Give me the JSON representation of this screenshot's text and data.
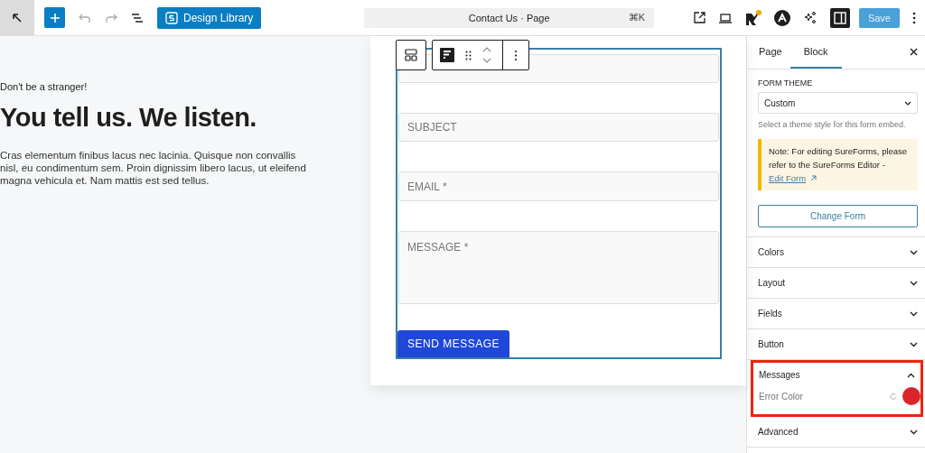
{
  "toolbar": {
    "design_library": "Design Library",
    "document_title": "Contact Us · Page",
    "shortcut": "⌘K",
    "save": "Save"
  },
  "content": {
    "eyebrow": "Don't be a stranger!",
    "heading": "You tell us. We listen.",
    "body": "Cras elementum finibus lacus nec lacinia. Quisque non convallis nisl, eu condimentum sem. Proin dignissim libero lacus, ut eleifend magna vehicula et. Nam mattis est sed tellus."
  },
  "form": {
    "fields": [
      {
        "kind": "input"
      },
      {
        "kind": "input",
        "placeholder": "SUBJECT"
      },
      {
        "kind": "input",
        "placeholder": "EMAIL *"
      },
      {
        "kind": "textarea",
        "placeholder": "MESSAGE *"
      }
    ],
    "submit": "SEND MESSAGE"
  },
  "sidebar": {
    "tabs": [
      {
        "label": "Page",
        "selected": false
      },
      {
        "label": "Block",
        "selected": true
      }
    ],
    "form_theme": {
      "label": "FORM THEME",
      "value": "Custom",
      "help": "Select a theme style for this form embed."
    },
    "notice": {
      "text": "Note: For editing SureForms, please refer to the SureForms Editor -",
      "link": "Edit Form"
    },
    "change_form": "Change Form",
    "panels": [
      {
        "title": "Colors",
        "expanded": false,
        "highlighted": false
      },
      {
        "title": "Layout",
        "expanded": false,
        "highlighted": false
      },
      {
        "title": "Fields",
        "expanded": false,
        "highlighted": false
      },
      {
        "title": "Button",
        "expanded": false,
        "highlighted": false
      },
      {
        "title": "Messages",
        "expanded": true,
        "highlighted": true,
        "settings": [
          {
            "label": "Error Color",
            "color": "#d9262c"
          }
        ]
      },
      {
        "title": "Advanced",
        "expanded": false,
        "highlighted": false
      }
    ]
  }
}
